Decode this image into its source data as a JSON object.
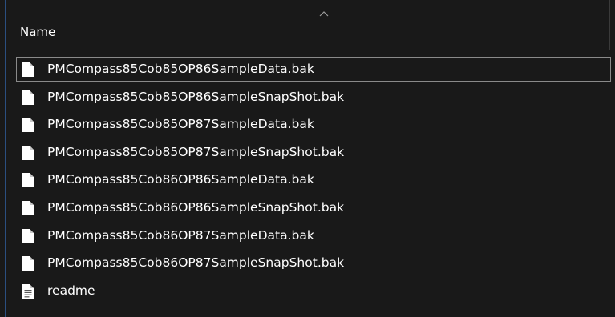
{
  "header": {
    "name_column": "Name"
  },
  "files": [
    {
      "name": "PMCompass85Cob85OP86SampleData.bak",
      "icon": "file-icon",
      "focused": true
    },
    {
      "name": "PMCompass85Cob85OP86SampleSnapShot.bak",
      "icon": "file-icon"
    },
    {
      "name": "PMCompass85Cob85OP87SampleData.bak",
      "icon": "file-icon"
    },
    {
      "name": "PMCompass85Cob85OP87SampleSnapShot.bak",
      "icon": "file-icon"
    },
    {
      "name": "PMCompass85Cob86OP86SampleData.bak",
      "icon": "file-icon"
    },
    {
      "name": "PMCompass85Cob86OP86SampleSnapShot.bak",
      "icon": "file-icon"
    },
    {
      "name": "PMCompass85Cob86OP87SampleData.bak",
      "icon": "file-icon"
    },
    {
      "name": "PMCompass85Cob86OP87SampleSnapShot.bak",
      "icon": "file-icon"
    },
    {
      "name": "readme",
      "icon": "text-file-icon"
    }
  ]
}
